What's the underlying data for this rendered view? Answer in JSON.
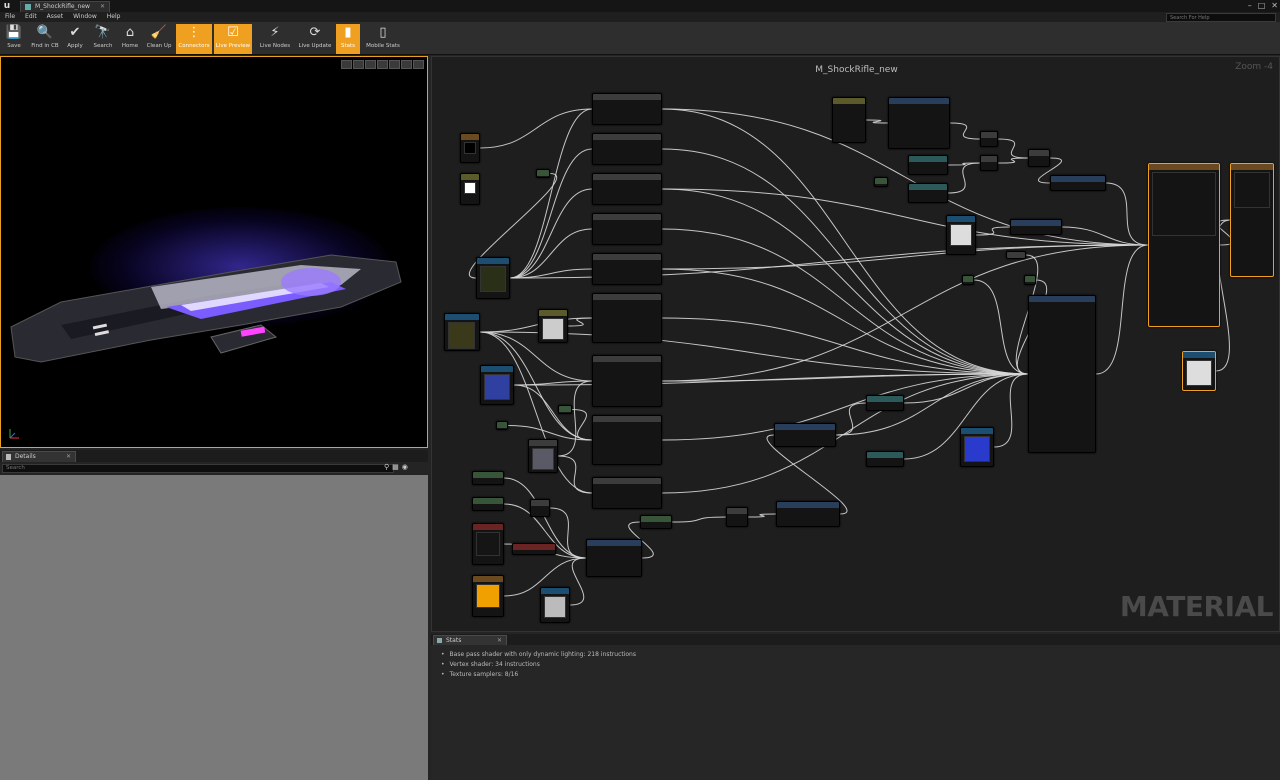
{
  "app": {
    "logo": "u",
    "doc_tab": "M_ShockRifle_new",
    "window_controls": [
      "–",
      "□",
      "✕"
    ]
  },
  "menu": [
    "File",
    "Edit",
    "Asset",
    "Window",
    "Help"
  ],
  "help_search": {
    "placeholder": "Search For Help"
  },
  "toolbar": [
    {
      "label": "Save",
      "icon": "save-icon",
      "glyph": "💾",
      "active": false
    },
    {
      "label": "Find in CB",
      "icon": "find-in-cb-icon",
      "glyph": "🔍",
      "active": false
    },
    {
      "label": "Apply",
      "icon": "apply-icon",
      "glyph": "✔",
      "active": false
    },
    {
      "label": "Search",
      "icon": "search-icon",
      "glyph": "🔭",
      "active": false
    },
    {
      "label": "Home",
      "icon": "home-icon",
      "glyph": "⌂",
      "active": false
    },
    {
      "label": "Clean Up",
      "icon": "clean-up-icon",
      "glyph": "🧹",
      "active": false
    },
    {
      "label": "Connectors",
      "icon": "connectors-icon",
      "glyph": "⋮",
      "active": true
    },
    {
      "label": "Live Preview",
      "icon": "live-preview-icon",
      "glyph": "☑",
      "active": true
    },
    {
      "label": "Live Nodes",
      "icon": "live-nodes-icon",
      "glyph": "⚡",
      "active": false
    },
    {
      "label": "Live Update",
      "icon": "live-update-icon",
      "glyph": "⟳",
      "active": false
    },
    {
      "label": "Stats",
      "icon": "stats-icon",
      "glyph": "▮",
      "active": true
    },
    {
      "label": "Mobile Stats",
      "icon": "mobile-stats-icon",
      "glyph": "▯",
      "active": false
    }
  ],
  "details": {
    "tab_label": "Details",
    "tab_close": "✕",
    "search_placeholder": "Search"
  },
  "graph": {
    "title": "M_ShockRifle_new",
    "zoom": "Zoom -4",
    "watermark": "MATERIAL"
  },
  "stats": {
    "tab_label": "Stats",
    "tab_close": "✕",
    "lines": [
      "Base pass shader with only dynamic lighting: 218 instructions",
      "Vertex shader: 34 instructions",
      "Texture samplers: 8/16"
    ]
  },
  "colors": {
    "accent": "#f0a020",
    "wire": "#d8d8d8",
    "viewport_glow": "#5a46ff"
  }
}
